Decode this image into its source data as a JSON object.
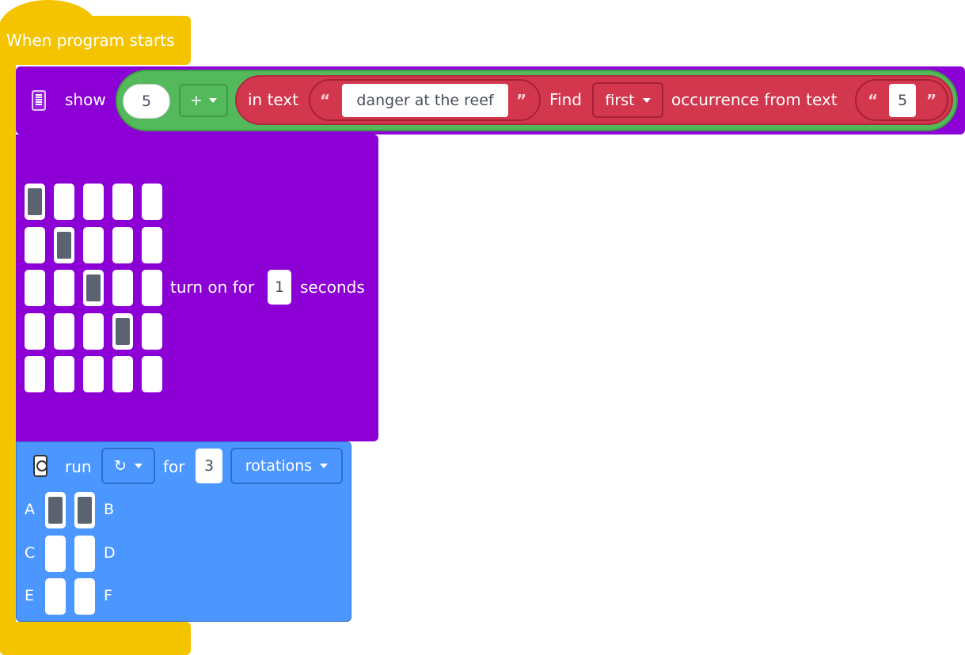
{
  "hat": {
    "title": "When program starts"
  },
  "show_block": {
    "label": "show",
    "icon": "matrix-display-icon",
    "number": "5",
    "operator": "+",
    "find": {
      "in_text_label": "in text",
      "text_value": "danger at the reef",
      "find_label": "Find",
      "mode": "first",
      "occurrence_label": "occurrence from text",
      "search_value": "5"
    }
  },
  "matrix_block": {
    "grid": [
      [
        1,
        0,
        0,
        0,
        0
      ],
      [
        0,
        1,
        0,
        0,
        0
      ],
      [
        0,
        0,
        1,
        0,
        0
      ],
      [
        0,
        0,
        0,
        1,
        0
      ],
      [
        0,
        0,
        0,
        0,
        0
      ]
    ],
    "turn_on_label": "turn on for",
    "seconds_value": "1",
    "seconds_label": "seconds"
  },
  "motor_block": {
    "icon": "motor-icon",
    "run_label": "run",
    "direction": "↻",
    "for_label": "for",
    "amount": "3",
    "unit": "rotations",
    "ports": [
      {
        "left": "A",
        "right": "B",
        "left_on": true,
        "right_on": true
      },
      {
        "left": "C",
        "right": "D",
        "left_on": false,
        "right_on": false
      },
      {
        "left": "E",
        "right": "F",
        "left_on": false,
        "right_on": false
      }
    ]
  },
  "quote_open": "“",
  "quote_close": "”",
  "colors": {
    "event": "#f5c400",
    "display": "#8c00d6",
    "operator": "#53b95a",
    "text": "#d2374e",
    "motor": "#4c97ff"
  }
}
